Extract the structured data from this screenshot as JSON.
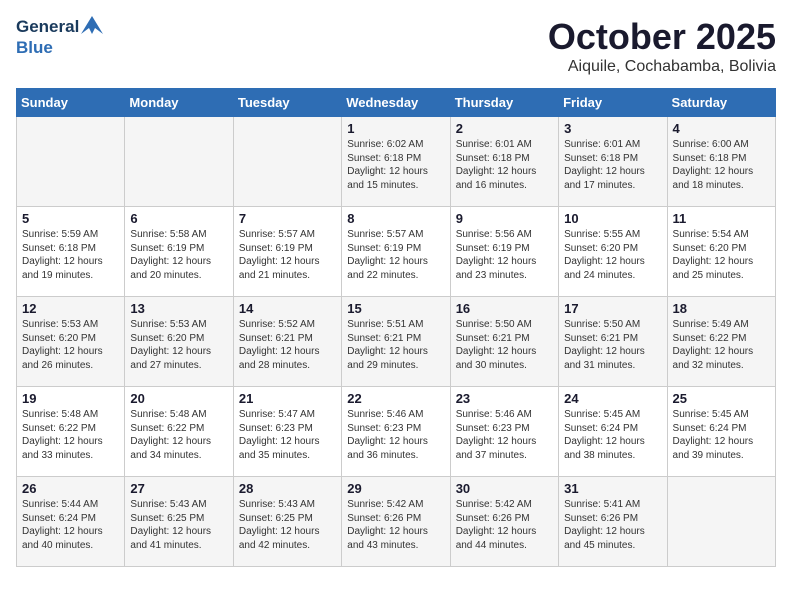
{
  "header": {
    "logo_line1": "General",
    "logo_line2": "Blue",
    "month": "October 2025",
    "location": "Aiquile, Cochabamba, Bolivia"
  },
  "weekdays": [
    "Sunday",
    "Monday",
    "Tuesday",
    "Wednesday",
    "Thursday",
    "Friday",
    "Saturday"
  ],
  "weeks": [
    [
      {
        "day": "",
        "sunrise": "",
        "sunset": "",
        "daylight": ""
      },
      {
        "day": "",
        "sunrise": "",
        "sunset": "",
        "daylight": ""
      },
      {
        "day": "",
        "sunrise": "",
        "sunset": "",
        "daylight": ""
      },
      {
        "day": "1",
        "sunrise": "Sunrise: 6:02 AM",
        "sunset": "Sunset: 6:18 PM",
        "daylight": "Daylight: 12 hours and 15 minutes."
      },
      {
        "day": "2",
        "sunrise": "Sunrise: 6:01 AM",
        "sunset": "Sunset: 6:18 PM",
        "daylight": "Daylight: 12 hours and 16 minutes."
      },
      {
        "day": "3",
        "sunrise": "Sunrise: 6:01 AM",
        "sunset": "Sunset: 6:18 PM",
        "daylight": "Daylight: 12 hours and 17 minutes."
      },
      {
        "day": "4",
        "sunrise": "Sunrise: 6:00 AM",
        "sunset": "Sunset: 6:18 PM",
        "daylight": "Daylight: 12 hours and 18 minutes."
      }
    ],
    [
      {
        "day": "5",
        "sunrise": "Sunrise: 5:59 AM",
        "sunset": "Sunset: 6:18 PM",
        "daylight": "Daylight: 12 hours and 19 minutes."
      },
      {
        "day": "6",
        "sunrise": "Sunrise: 5:58 AM",
        "sunset": "Sunset: 6:19 PM",
        "daylight": "Daylight: 12 hours and 20 minutes."
      },
      {
        "day": "7",
        "sunrise": "Sunrise: 5:57 AM",
        "sunset": "Sunset: 6:19 PM",
        "daylight": "Daylight: 12 hours and 21 minutes."
      },
      {
        "day": "8",
        "sunrise": "Sunrise: 5:57 AM",
        "sunset": "Sunset: 6:19 PM",
        "daylight": "Daylight: 12 hours and 22 minutes."
      },
      {
        "day": "9",
        "sunrise": "Sunrise: 5:56 AM",
        "sunset": "Sunset: 6:19 PM",
        "daylight": "Daylight: 12 hours and 23 minutes."
      },
      {
        "day": "10",
        "sunrise": "Sunrise: 5:55 AM",
        "sunset": "Sunset: 6:20 PM",
        "daylight": "Daylight: 12 hours and 24 minutes."
      },
      {
        "day": "11",
        "sunrise": "Sunrise: 5:54 AM",
        "sunset": "Sunset: 6:20 PM",
        "daylight": "Daylight: 12 hours and 25 minutes."
      }
    ],
    [
      {
        "day": "12",
        "sunrise": "Sunrise: 5:53 AM",
        "sunset": "Sunset: 6:20 PM",
        "daylight": "Daylight: 12 hours and 26 minutes."
      },
      {
        "day": "13",
        "sunrise": "Sunrise: 5:53 AM",
        "sunset": "Sunset: 6:20 PM",
        "daylight": "Daylight: 12 hours and 27 minutes."
      },
      {
        "day": "14",
        "sunrise": "Sunrise: 5:52 AM",
        "sunset": "Sunset: 6:21 PM",
        "daylight": "Daylight: 12 hours and 28 minutes."
      },
      {
        "day": "15",
        "sunrise": "Sunrise: 5:51 AM",
        "sunset": "Sunset: 6:21 PM",
        "daylight": "Daylight: 12 hours and 29 minutes."
      },
      {
        "day": "16",
        "sunrise": "Sunrise: 5:50 AM",
        "sunset": "Sunset: 6:21 PM",
        "daylight": "Daylight: 12 hours and 30 minutes."
      },
      {
        "day": "17",
        "sunrise": "Sunrise: 5:50 AM",
        "sunset": "Sunset: 6:21 PM",
        "daylight": "Daylight: 12 hours and 31 minutes."
      },
      {
        "day": "18",
        "sunrise": "Sunrise: 5:49 AM",
        "sunset": "Sunset: 6:22 PM",
        "daylight": "Daylight: 12 hours and 32 minutes."
      }
    ],
    [
      {
        "day": "19",
        "sunrise": "Sunrise: 5:48 AM",
        "sunset": "Sunset: 6:22 PM",
        "daylight": "Daylight: 12 hours and 33 minutes."
      },
      {
        "day": "20",
        "sunrise": "Sunrise: 5:48 AM",
        "sunset": "Sunset: 6:22 PM",
        "daylight": "Daylight: 12 hours and 34 minutes."
      },
      {
        "day": "21",
        "sunrise": "Sunrise: 5:47 AM",
        "sunset": "Sunset: 6:23 PM",
        "daylight": "Daylight: 12 hours and 35 minutes."
      },
      {
        "day": "22",
        "sunrise": "Sunrise: 5:46 AM",
        "sunset": "Sunset: 6:23 PM",
        "daylight": "Daylight: 12 hours and 36 minutes."
      },
      {
        "day": "23",
        "sunrise": "Sunrise: 5:46 AM",
        "sunset": "Sunset: 6:23 PM",
        "daylight": "Daylight: 12 hours and 37 minutes."
      },
      {
        "day": "24",
        "sunrise": "Sunrise: 5:45 AM",
        "sunset": "Sunset: 6:24 PM",
        "daylight": "Daylight: 12 hours and 38 minutes."
      },
      {
        "day": "25",
        "sunrise": "Sunrise: 5:45 AM",
        "sunset": "Sunset: 6:24 PM",
        "daylight": "Daylight: 12 hours and 39 minutes."
      }
    ],
    [
      {
        "day": "26",
        "sunrise": "Sunrise: 5:44 AM",
        "sunset": "Sunset: 6:24 PM",
        "daylight": "Daylight: 12 hours and 40 minutes."
      },
      {
        "day": "27",
        "sunrise": "Sunrise: 5:43 AM",
        "sunset": "Sunset: 6:25 PM",
        "daylight": "Daylight: 12 hours and 41 minutes."
      },
      {
        "day": "28",
        "sunrise": "Sunrise: 5:43 AM",
        "sunset": "Sunset: 6:25 PM",
        "daylight": "Daylight: 12 hours and 42 minutes."
      },
      {
        "day": "29",
        "sunrise": "Sunrise: 5:42 AM",
        "sunset": "Sunset: 6:26 PM",
        "daylight": "Daylight: 12 hours and 43 minutes."
      },
      {
        "day": "30",
        "sunrise": "Sunrise: 5:42 AM",
        "sunset": "Sunset: 6:26 PM",
        "daylight": "Daylight: 12 hours and 44 minutes."
      },
      {
        "day": "31",
        "sunrise": "Sunrise: 5:41 AM",
        "sunset": "Sunset: 6:26 PM",
        "daylight": "Daylight: 12 hours and 45 minutes."
      },
      {
        "day": "",
        "sunrise": "",
        "sunset": "",
        "daylight": ""
      }
    ]
  ]
}
